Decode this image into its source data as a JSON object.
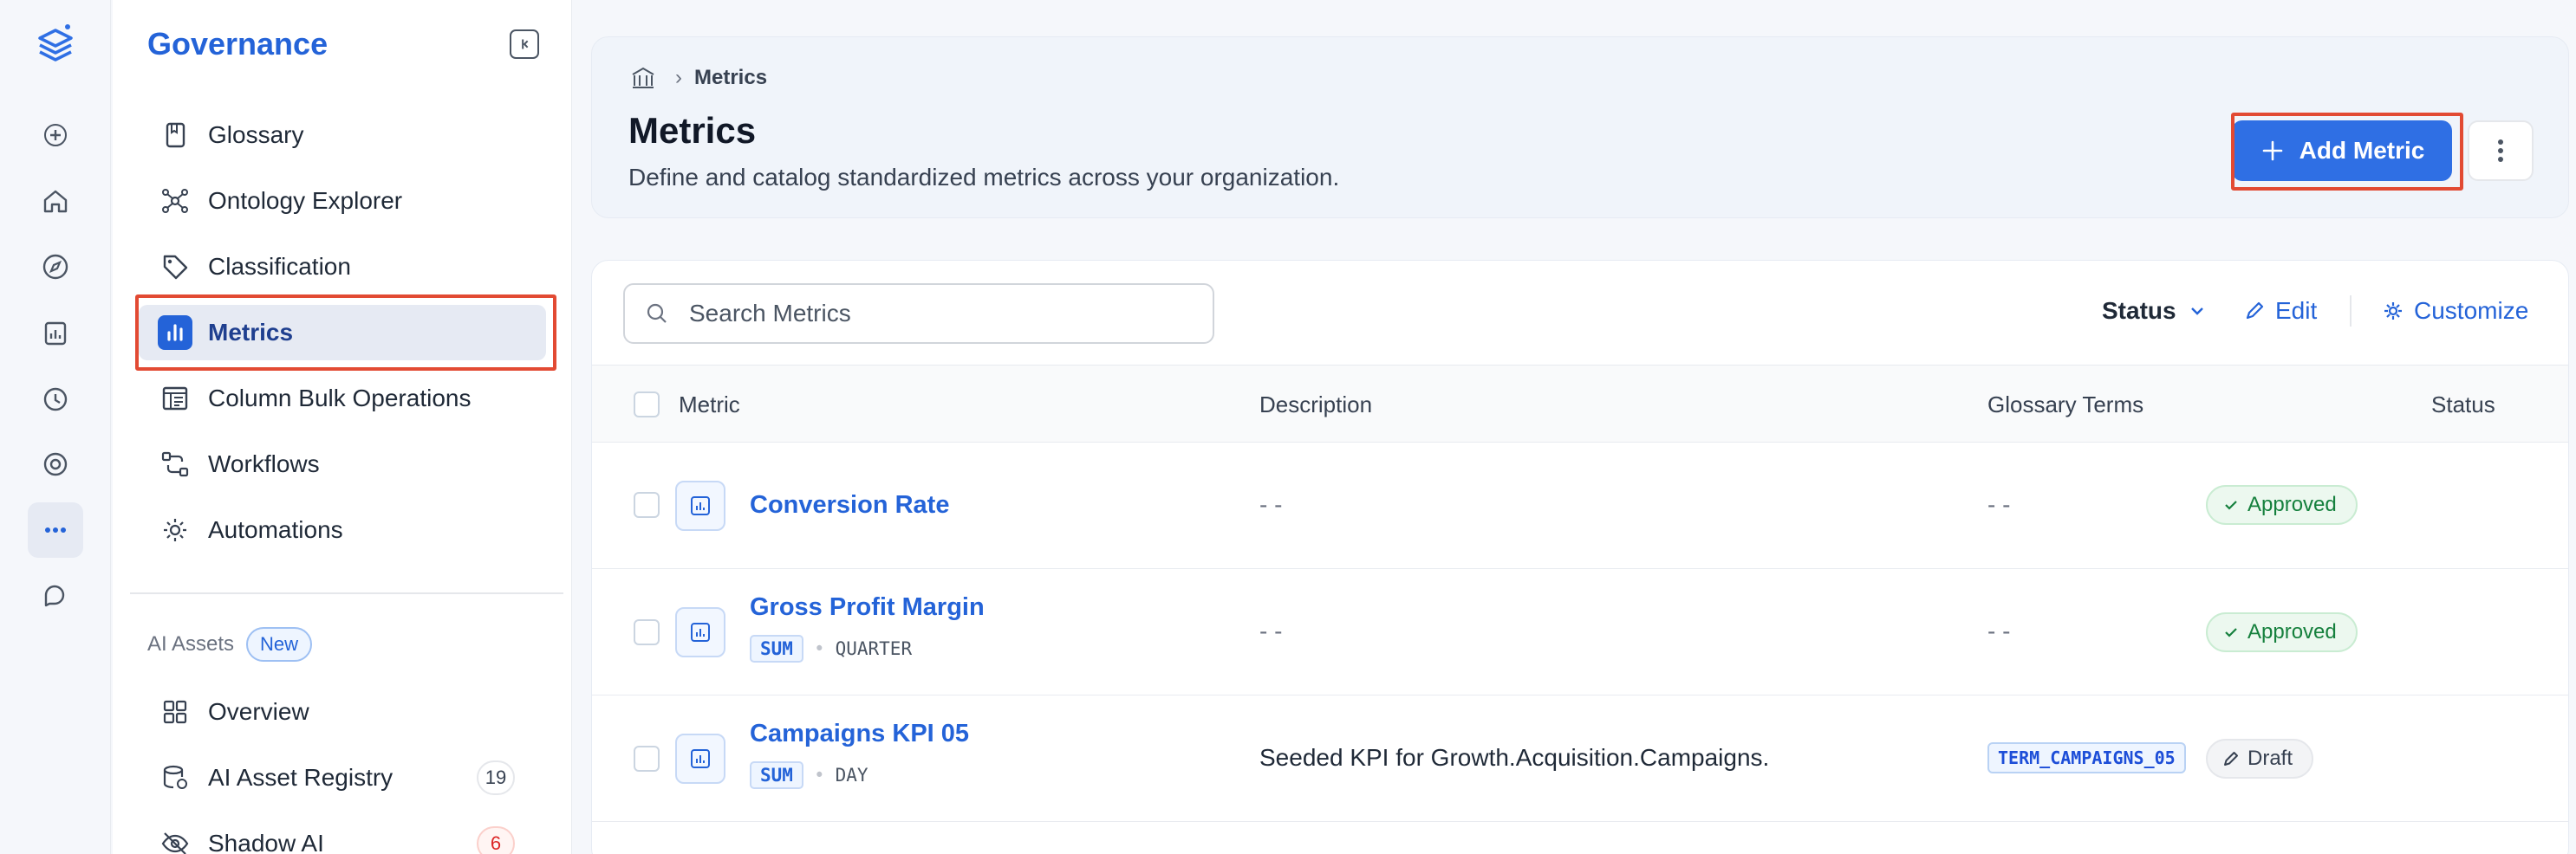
{
  "sidebar": {
    "title": "Governance",
    "items": [
      {
        "label": "Glossary",
        "icon": "book-icon"
      },
      {
        "label": "Ontology Explorer",
        "icon": "network-icon"
      },
      {
        "label": "Classification",
        "icon": "tag-icon"
      },
      {
        "label": "Metrics",
        "icon": "bar-chart-icon",
        "active": true
      },
      {
        "label": "Column Bulk Operations",
        "icon": "table-icon"
      },
      {
        "label": "Workflows",
        "icon": "workflow-icon"
      },
      {
        "label": "Automations",
        "icon": "gear-sync-icon"
      }
    ],
    "ai_assets": {
      "heading": "AI Assets",
      "badge": "New",
      "items": [
        {
          "label": "Overview",
          "icon": "grid-icon"
        },
        {
          "label": "AI Asset Registry",
          "icon": "database-icon",
          "count": "19"
        },
        {
          "label": "Shadow AI",
          "icon": "eye-off-icon",
          "count": "6"
        }
      ]
    }
  },
  "header": {
    "breadcrumb": {
      "current": "Metrics"
    },
    "title": "Metrics",
    "subtitle": "Define and catalog standardized metrics across your organization.",
    "add_button": "Add Metric"
  },
  "toolbar": {
    "search_placeholder": "Search Metrics",
    "status_filter": "Status",
    "edit": "Edit",
    "customize": "Customize"
  },
  "table": {
    "columns": [
      "Metric",
      "Description",
      "Glossary Terms",
      "Status"
    ],
    "rows": [
      {
        "name": "Conversion Rate",
        "description": "- -",
        "glossary": "- -",
        "status": "Approved"
      },
      {
        "name": "Gross Profit Margin",
        "agg": "SUM",
        "granularity": "QUARTER",
        "description": "- -",
        "glossary": "- -",
        "status": "Approved"
      },
      {
        "name": "Campaigns KPI 05",
        "agg": "SUM",
        "granularity": "DAY",
        "description": "Seeded KPI for Growth.Acquisition.Campaigns.",
        "glossary_term": "TERM_CAMPAIGNS_05",
        "status": "Draft"
      }
    ]
  },
  "colors": {
    "accent": "#2463d8",
    "primary_button": "#2f6fe4",
    "highlight": "#e24a33",
    "approved": "#15803d"
  }
}
